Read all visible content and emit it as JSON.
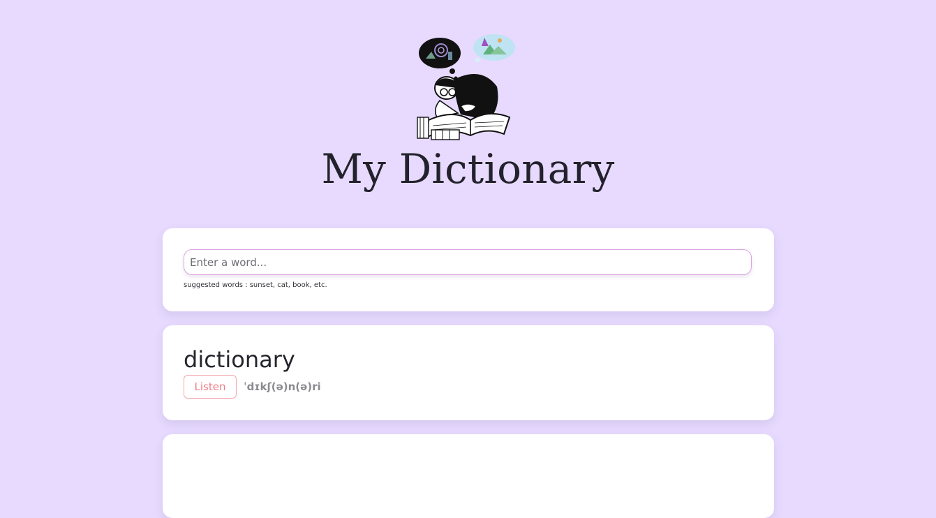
{
  "header": {
    "title": "My Dictionary",
    "logo_icon": "reading-scholar-icon"
  },
  "search": {
    "placeholder": "Enter a word...",
    "value": "",
    "hint": "suggested words : sunset, cat, book, etc."
  },
  "result": {
    "word": "dictionary",
    "listen_label": "Listen",
    "phonetic": "ˈdɪkʃ(ə)n(ə)ri"
  },
  "colors": {
    "background": "#e7dafe",
    "card": "#ffffff",
    "accent": "#f07c86",
    "input_border": "#dba3e2"
  }
}
